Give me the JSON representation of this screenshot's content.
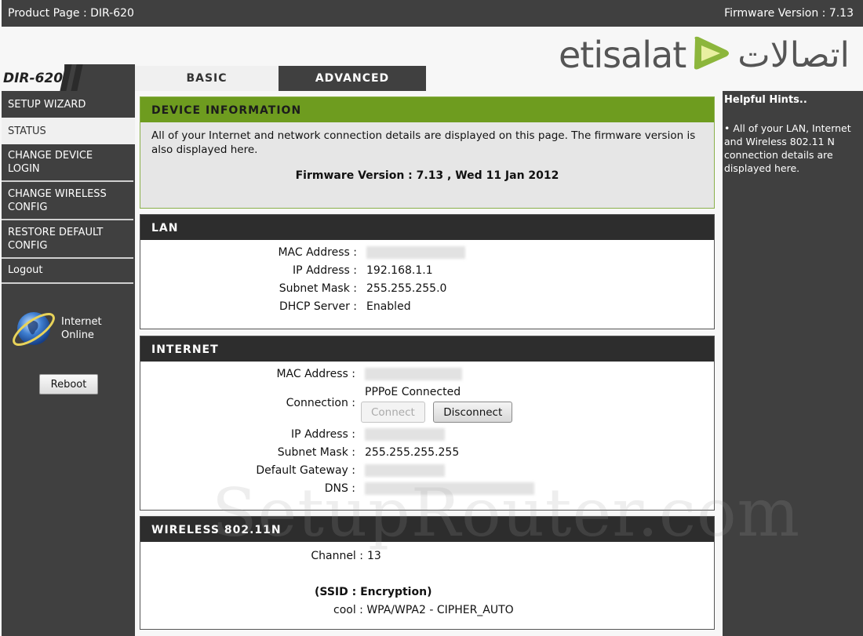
{
  "topbar": {
    "product_page": "Product Page :  DIR-620",
    "firmware": "Firmware Version : 7.13"
  },
  "brand": {
    "latin": "etisalat",
    "arabic": "اتصالات",
    "accent_color": "#8cb63c"
  },
  "model": "DIR-620",
  "tabs": [
    {
      "label": "BASIC",
      "active": true
    },
    {
      "label": "ADVANCED",
      "active": false
    }
  ],
  "sidebar": {
    "items": [
      {
        "label": "SETUP WIZARD",
        "active": false
      },
      {
        "label": "STATUS",
        "active": true
      },
      {
        "label": "CHANGE DEVICE LOGIN",
        "active": false
      },
      {
        "label": "CHANGE WIRELESS CONFIG",
        "active": false
      },
      {
        "label": "RESTORE DEFAULT CONFIG",
        "active": false
      },
      {
        "label": "Logout",
        "active": false
      }
    ],
    "status_line1": "Internet",
    "status_line2": "Online",
    "status_icon": "globe-icon",
    "reboot_label": "Reboot"
  },
  "device_info": {
    "title": "DEVICE INFORMATION",
    "description": "All of your Internet and network connection details are displayed on this page. The firmware version is also displayed here.",
    "firmware_line": "Firmware Version : 7.13 ,  Wed 11 Jan 2012"
  },
  "lan": {
    "title": "LAN",
    "rows": [
      {
        "label": "MAC Address :",
        "value": ""
      },
      {
        "label": "IP Address :",
        "value": "192.168.1.1"
      },
      {
        "label": "Subnet Mask :",
        "value": "255.255.255.0"
      },
      {
        "label": "DHCP Server :",
        "value": "Enabled"
      }
    ]
  },
  "internet": {
    "title": "INTERNET",
    "mac_label": "MAC Address :",
    "connection_label": "Connection :",
    "connection_status": "PPPoE  Connected",
    "connect_label": "Connect",
    "disconnect_label": "Disconnect",
    "ip_label": "IP Address :",
    "subnet_label": "Subnet Mask :",
    "subnet_value": "255.255.255.255",
    "gateway_label": "Default Gateway :",
    "dns_label": "DNS :"
  },
  "wireless": {
    "title": "WIRELESS 802.11N",
    "channel_label": "Channel :",
    "channel_value": "13",
    "ssid_header": "(SSID :  Encryption)",
    "ssid_row": "cool : WPA/WPA2 - CIPHER_AUTO"
  },
  "hints": {
    "title": "Helpful Hints..",
    "body": "• All of your LAN, Internet and Wireless 802.11 N connection details are displayed here."
  },
  "watermark": "SetupRouter.com"
}
